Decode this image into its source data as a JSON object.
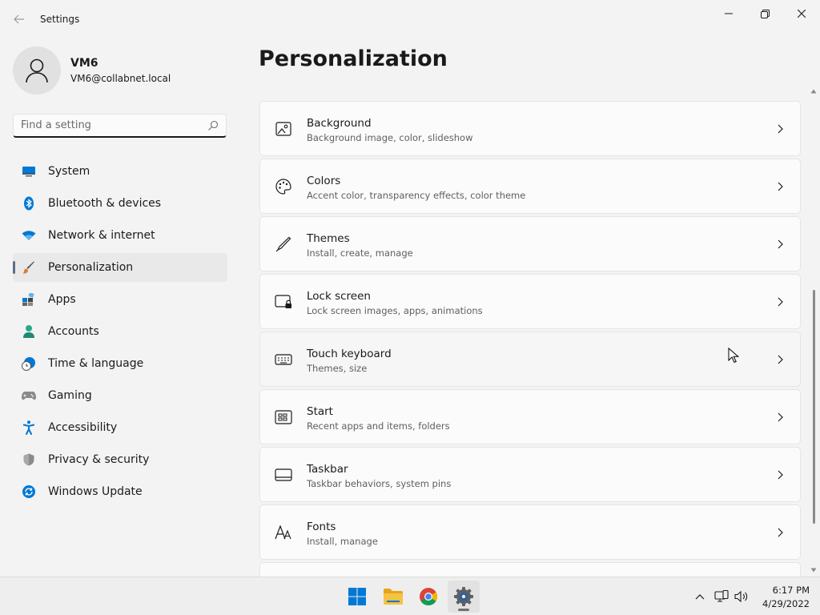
{
  "window": {
    "title": "Settings",
    "controls": [
      "minimize",
      "maximize",
      "close"
    ]
  },
  "profile": {
    "name": "VM6",
    "email": "VM6@collabnet.local"
  },
  "search": {
    "placeholder": "Find a setting",
    "value": ""
  },
  "nav": {
    "items": [
      {
        "label": "System",
        "icon": "system-icon",
        "selected": false
      },
      {
        "label": "Bluetooth & devices",
        "icon": "bluetooth-icon",
        "selected": false
      },
      {
        "label": "Network & internet",
        "icon": "wifi-icon",
        "selected": false
      },
      {
        "label": "Personalization",
        "icon": "brush-icon",
        "selected": true
      },
      {
        "label": "Apps",
        "icon": "apps-icon",
        "selected": false
      },
      {
        "label": "Accounts",
        "icon": "person-icon",
        "selected": false
      },
      {
        "label": "Time & language",
        "icon": "clock-globe-icon",
        "selected": false
      },
      {
        "label": "Gaming",
        "icon": "gamepad-icon",
        "selected": false
      },
      {
        "label": "Accessibility",
        "icon": "accessibility-icon",
        "selected": false
      },
      {
        "label": "Privacy & security",
        "icon": "shield-icon",
        "selected": false
      },
      {
        "label": "Windows Update",
        "icon": "update-icon",
        "selected": false
      }
    ]
  },
  "main": {
    "title": "Personalization",
    "cards": [
      {
        "title": "Background",
        "subtitle": "Background image, color, slideshow",
        "icon": "image-icon"
      },
      {
        "title": "Colors",
        "subtitle": "Accent color, transparency effects, color theme",
        "icon": "palette-icon"
      },
      {
        "title": "Themes",
        "subtitle": "Install, create, manage",
        "icon": "pen-icon"
      },
      {
        "title": "Lock screen",
        "subtitle": "Lock screen images, apps, animations",
        "icon": "lock-screen-icon"
      },
      {
        "title": "Touch keyboard",
        "subtitle": "Themes, size",
        "icon": "keyboard-icon"
      },
      {
        "title": "Start",
        "subtitle": "Recent apps and items, folders",
        "icon": "start-icon"
      },
      {
        "title": "Taskbar",
        "subtitle": "Taskbar behaviors, system pins",
        "icon": "taskbar-icon"
      },
      {
        "title": "Fonts",
        "subtitle": "Install, manage",
        "icon": "fonts-icon"
      }
    ]
  },
  "taskbar": {
    "apps": [
      "windows-start-icon",
      "file-explorer-icon",
      "chrome-icon",
      "settings-icon"
    ],
    "active_app": "settings-icon",
    "tray": [
      "show-hidden-icons-icon",
      "network-icon",
      "volume-icon"
    ],
    "time": "6:17 PM",
    "date": "4/29/2022"
  },
  "colors": {
    "accent_windows": "#0078d4",
    "folder_yellow": "#f5c242",
    "selection_indicator": "#5a6e87"
  }
}
